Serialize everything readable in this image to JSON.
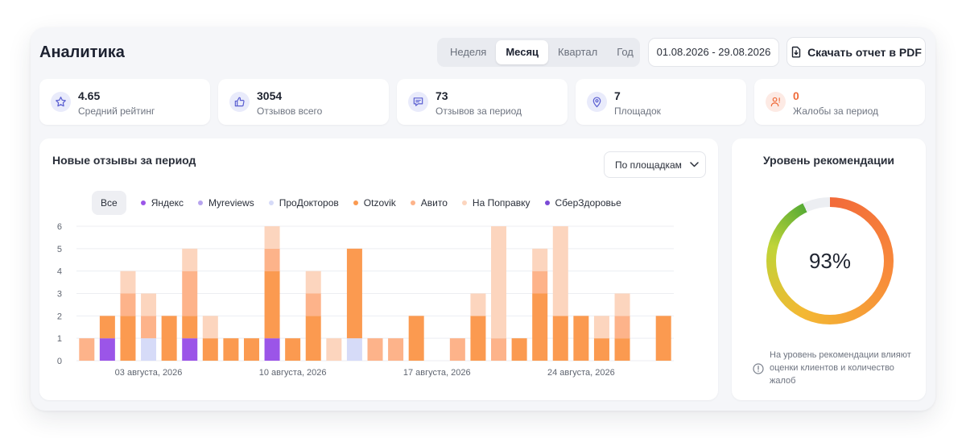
{
  "header": {
    "title": "Аналитика",
    "periods": [
      "Неделя",
      "Месяц",
      "Квартал",
      "Год"
    ],
    "active_period": "Месяц",
    "date_range": "01.08.2026 - 29.08.2026",
    "pdf_label": "Скачать отчет в PDF"
  },
  "stats": [
    {
      "value": "4.65",
      "label": "Средний рейтинг",
      "icon": "star-icon"
    },
    {
      "value": "3054",
      "label": "Отзывов всего",
      "icon": "thumbs-up-icon"
    },
    {
      "value": "73",
      "label": "Отзывов за период",
      "icon": "message-icon"
    },
    {
      "value": "7",
      "label": "Площадок",
      "icon": "location-pin-icon"
    },
    {
      "value": "0",
      "label": "Жалобы за период",
      "icon": "user-alert-icon",
      "warn": true
    }
  ],
  "chart_card": {
    "title": "Новые отзывы за период",
    "dropdown": "По площадкам",
    "legend_all": "Все"
  },
  "chart_data": {
    "type": "bar",
    "stacked": true,
    "yticks": [
      0,
      1,
      2,
      3,
      4,
      5,
      6
    ],
    "ylim": [
      0,
      6
    ],
    "grid": true,
    "x_tick_labels": [
      {
        "label": "03 августа, 2026",
        "index": 3
      },
      {
        "label": "10 августа, 2026",
        "index": 10
      },
      {
        "label": "17 августа, 2026",
        "index": 17
      },
      {
        "label": "24 августа, 2026",
        "index": 24
      }
    ],
    "categories": [
      "1",
      "2",
      "3",
      "4",
      "5",
      "6",
      "7",
      "8",
      "9",
      "10",
      "11",
      "12",
      "13",
      "14",
      "15",
      "16",
      "17",
      "18",
      "19",
      "20",
      "21",
      "22",
      "23",
      "24",
      "25",
      "26",
      "27",
      "28",
      "29"
    ],
    "series": [
      {
        "name": "Яндекс",
        "color": "#9b55e8",
        "values": [
          0,
          1,
          0,
          0,
          0,
          1,
          0,
          0,
          0,
          1,
          0,
          0,
          0,
          0,
          0,
          0,
          0,
          0,
          0,
          0,
          0,
          0,
          0,
          0,
          0,
          0,
          0,
          0,
          0
        ]
      },
      {
        "name": "Myreviews",
        "color": "#b7a4ee",
        "values": [
          0,
          0,
          0,
          0,
          0,
          0,
          0,
          0,
          0,
          0,
          0,
          0,
          0,
          0,
          0,
          0,
          0,
          0,
          0,
          0,
          0,
          0,
          0,
          0,
          0,
          0,
          0,
          0,
          0
        ]
      },
      {
        "name": "ПроДокторов",
        "color": "#d6dbf8",
        "values": [
          0,
          0,
          0,
          1,
          0,
          0,
          0,
          0,
          0,
          0,
          0,
          0,
          0,
          1,
          0,
          0,
          0,
          0,
          0,
          0,
          0,
          0,
          0,
          0,
          0,
          0,
          0,
          0,
          0
        ]
      },
      {
        "name": "Otzovik",
        "color": "#fb9a50",
        "values": [
          0,
          1,
          2,
          0,
          2,
          1,
          1,
          1,
          1,
          3,
          1,
          2,
          0,
          4,
          0,
          0,
          2,
          0,
          0,
          2,
          0,
          1,
          3,
          2,
          2,
          1,
          1,
          0,
          2
        ]
      },
      {
        "name": "Авито",
        "color": "#fdb38a",
        "values": [
          1,
          0,
          1,
          1,
          0,
          2,
          0,
          0,
          0,
          1,
          0,
          1,
          0,
          0,
          1,
          1,
          0,
          0,
          1,
          0,
          1,
          0,
          1,
          0,
          0,
          0,
          1,
          0,
          0
        ]
      },
      {
        "name": "На Поправку",
        "color": "#fcd5be",
        "values": [
          0,
          0,
          1,
          1,
          0,
          1,
          1,
          0,
          0,
          1,
          0,
          1,
          1,
          0,
          0,
          0,
          0,
          0,
          0,
          1,
          5,
          0,
          1,
          4,
          0,
          1,
          1,
          0,
          0
        ]
      },
      {
        "name": "СберЗдоровье",
        "color": "#7a4ad6",
        "values": [
          0,
          0,
          0,
          0,
          0,
          0,
          0,
          0,
          0,
          0,
          0,
          0,
          0,
          0,
          0,
          0,
          0,
          0,
          0,
          0,
          0,
          0,
          0,
          0,
          0,
          0,
          0,
          0,
          0
        ]
      }
    ]
  },
  "recommendation": {
    "title": "Уровень рекомендации",
    "value_text": "93%",
    "value": 93,
    "note": "На уровень рекомендации влияют оценки клиентов и количество жалоб"
  }
}
